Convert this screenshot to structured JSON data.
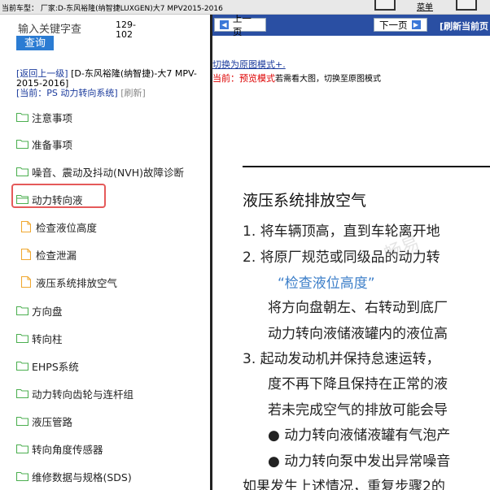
{
  "topbar": {
    "car_text": "当前车型： 厂家:D-东风裕隆(纳智捷LUXGEN)大7 MPV2015-2016",
    "menu_label": "菜单"
  },
  "search": {
    "label": "输入关键字查",
    "count_top": "129-",
    "count_bottom": "102",
    "button": "查询"
  },
  "nav": {
    "back": "[返回上一级]",
    "model": "[D-东风裕隆(纳智捷)-大7 MPV-2015-2016]",
    "current": "[当前：PS 动力转向系统]",
    "refresh": "[刷新]"
  },
  "tree": [
    {
      "label": "注意事项",
      "type": "folder"
    },
    {
      "label": "准备事项",
      "type": "folder"
    },
    {
      "label": "噪音、震动及抖动(NVH)故障诊断",
      "type": "folder"
    },
    {
      "label": "动力转向液",
      "type": "folder-open"
    },
    {
      "label": "检查液位高度",
      "type": "doc"
    },
    {
      "label": "检查泄漏",
      "type": "doc"
    },
    {
      "label": "液压系统排放空气",
      "type": "doc"
    },
    {
      "label": "方向盘",
      "type": "folder"
    },
    {
      "label": "转向柱",
      "type": "folder"
    },
    {
      "label": "EHPS系统",
      "type": "folder"
    },
    {
      "label": "动力转向齿轮与连杆组",
      "type": "folder"
    },
    {
      "label": "液压管路",
      "type": "folder"
    },
    {
      "label": "转向角度传感器",
      "type": "folder"
    },
    {
      "label": "维修数据与规格(SDS)",
      "type": "folder"
    }
  ],
  "right": {
    "prev_page": "上一页",
    "next_page": "下一页",
    "refresh_current": "[刷新当前页",
    "switch_link": "切换为原图模式+.",
    "preview_prefix": "当前：预览模式",
    "preview_suffix": "若需看大图，切换至原图模式"
  },
  "document": {
    "title": "液压系统排放空气",
    "lines": [
      {
        "text": "1.  将车辆顶高，直到车轮离开地",
        "style": "normal"
      },
      {
        "text": "2.  将原厂规范或同级品的动力转",
        "style": "normal"
      },
      {
        "text": "“检查液位高度”",
        "style": "blue"
      },
      {
        "text": "将方向盘朝左、右转动到底厂",
        "style": "normal"
      },
      {
        "text": "动力转向液储液罐内的液位高",
        "style": "normal"
      },
      {
        "text": "3.  起动发动机并保持怠速运转，",
        "style": "normal"
      },
      {
        "text": "度不再下降且保持在正常的液",
        "style": "normal"
      },
      {
        "text": "若未完成空气的排放可能会导",
        "style": "normal"
      },
      {
        "text": "●   动力转向液储液罐有气泡产",
        "style": "normal"
      },
      {
        "text": "●   动力转向泵中发出异常噪音",
        "style": "normal"
      },
      {
        "text": "如果发生上述情况，重复步骤2的",
        "style": "normal"
      }
    ]
  },
  "colors": {
    "accent": "#2a4fa3",
    "button": "#2b7cd3",
    "highlight": "#e55a5a",
    "link": "#1a3a9c"
  }
}
